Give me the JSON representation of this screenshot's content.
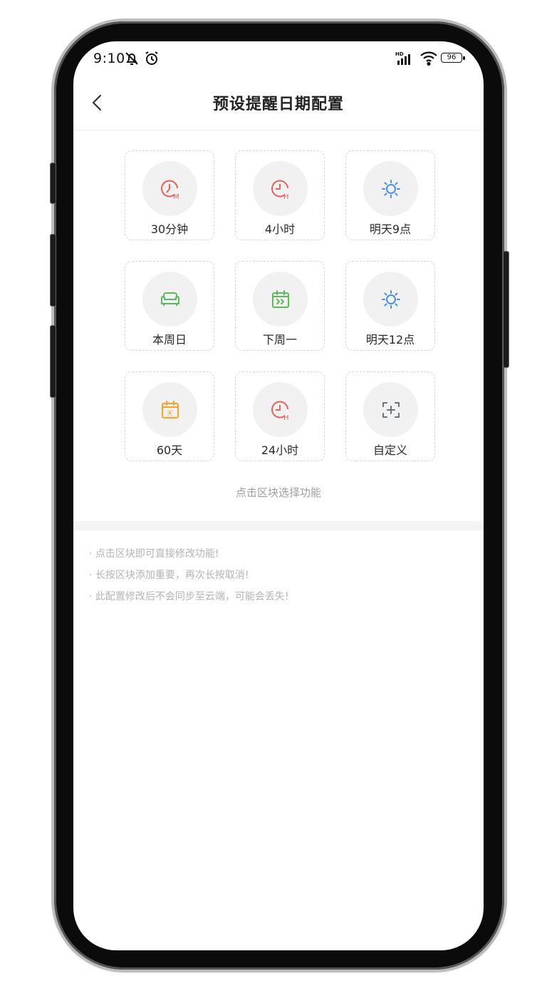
{
  "status_bar": {
    "time": "9:10",
    "network": "HD",
    "battery": "96"
  },
  "header": {
    "title": "预设提醒日期配置"
  },
  "tiles": [
    {
      "label": "30分钟",
      "icon": "clock-minutes-icon",
      "icon_text": "M",
      "color": "#e8625a"
    },
    {
      "label": "4小时",
      "icon": "clock-hours-icon",
      "icon_text": "H",
      "color": "#e8625a"
    },
    {
      "label": "明天9点",
      "icon": "sun-icon",
      "color": "#4a90e8"
    },
    {
      "label": "本周日",
      "icon": "sofa-icon",
      "color": "#5cb85c"
    },
    {
      "label": "下周一",
      "icon": "calendar-next-icon",
      "color": "#5cb85c"
    },
    {
      "label": "明天12点",
      "icon": "sun-icon",
      "color": "#4a90e8"
    },
    {
      "label": "60天",
      "icon": "calendar-day-icon",
      "icon_text": "天",
      "color": "#f5a623"
    },
    {
      "label": "24小时",
      "icon": "clock-hours-icon",
      "icon_text": "H",
      "color": "#e8625a"
    },
    {
      "label": "自定义",
      "icon": "custom-plus-icon",
      "color": "#6b7280"
    }
  ],
  "hint": "点击区块选择功能",
  "tips": [
    "· 点击区块即可直接修改功能!",
    "· 长按区块添加重要，再次长按取消!",
    "· 此配置修改后不会同步至云端，可能会丢失!"
  ]
}
